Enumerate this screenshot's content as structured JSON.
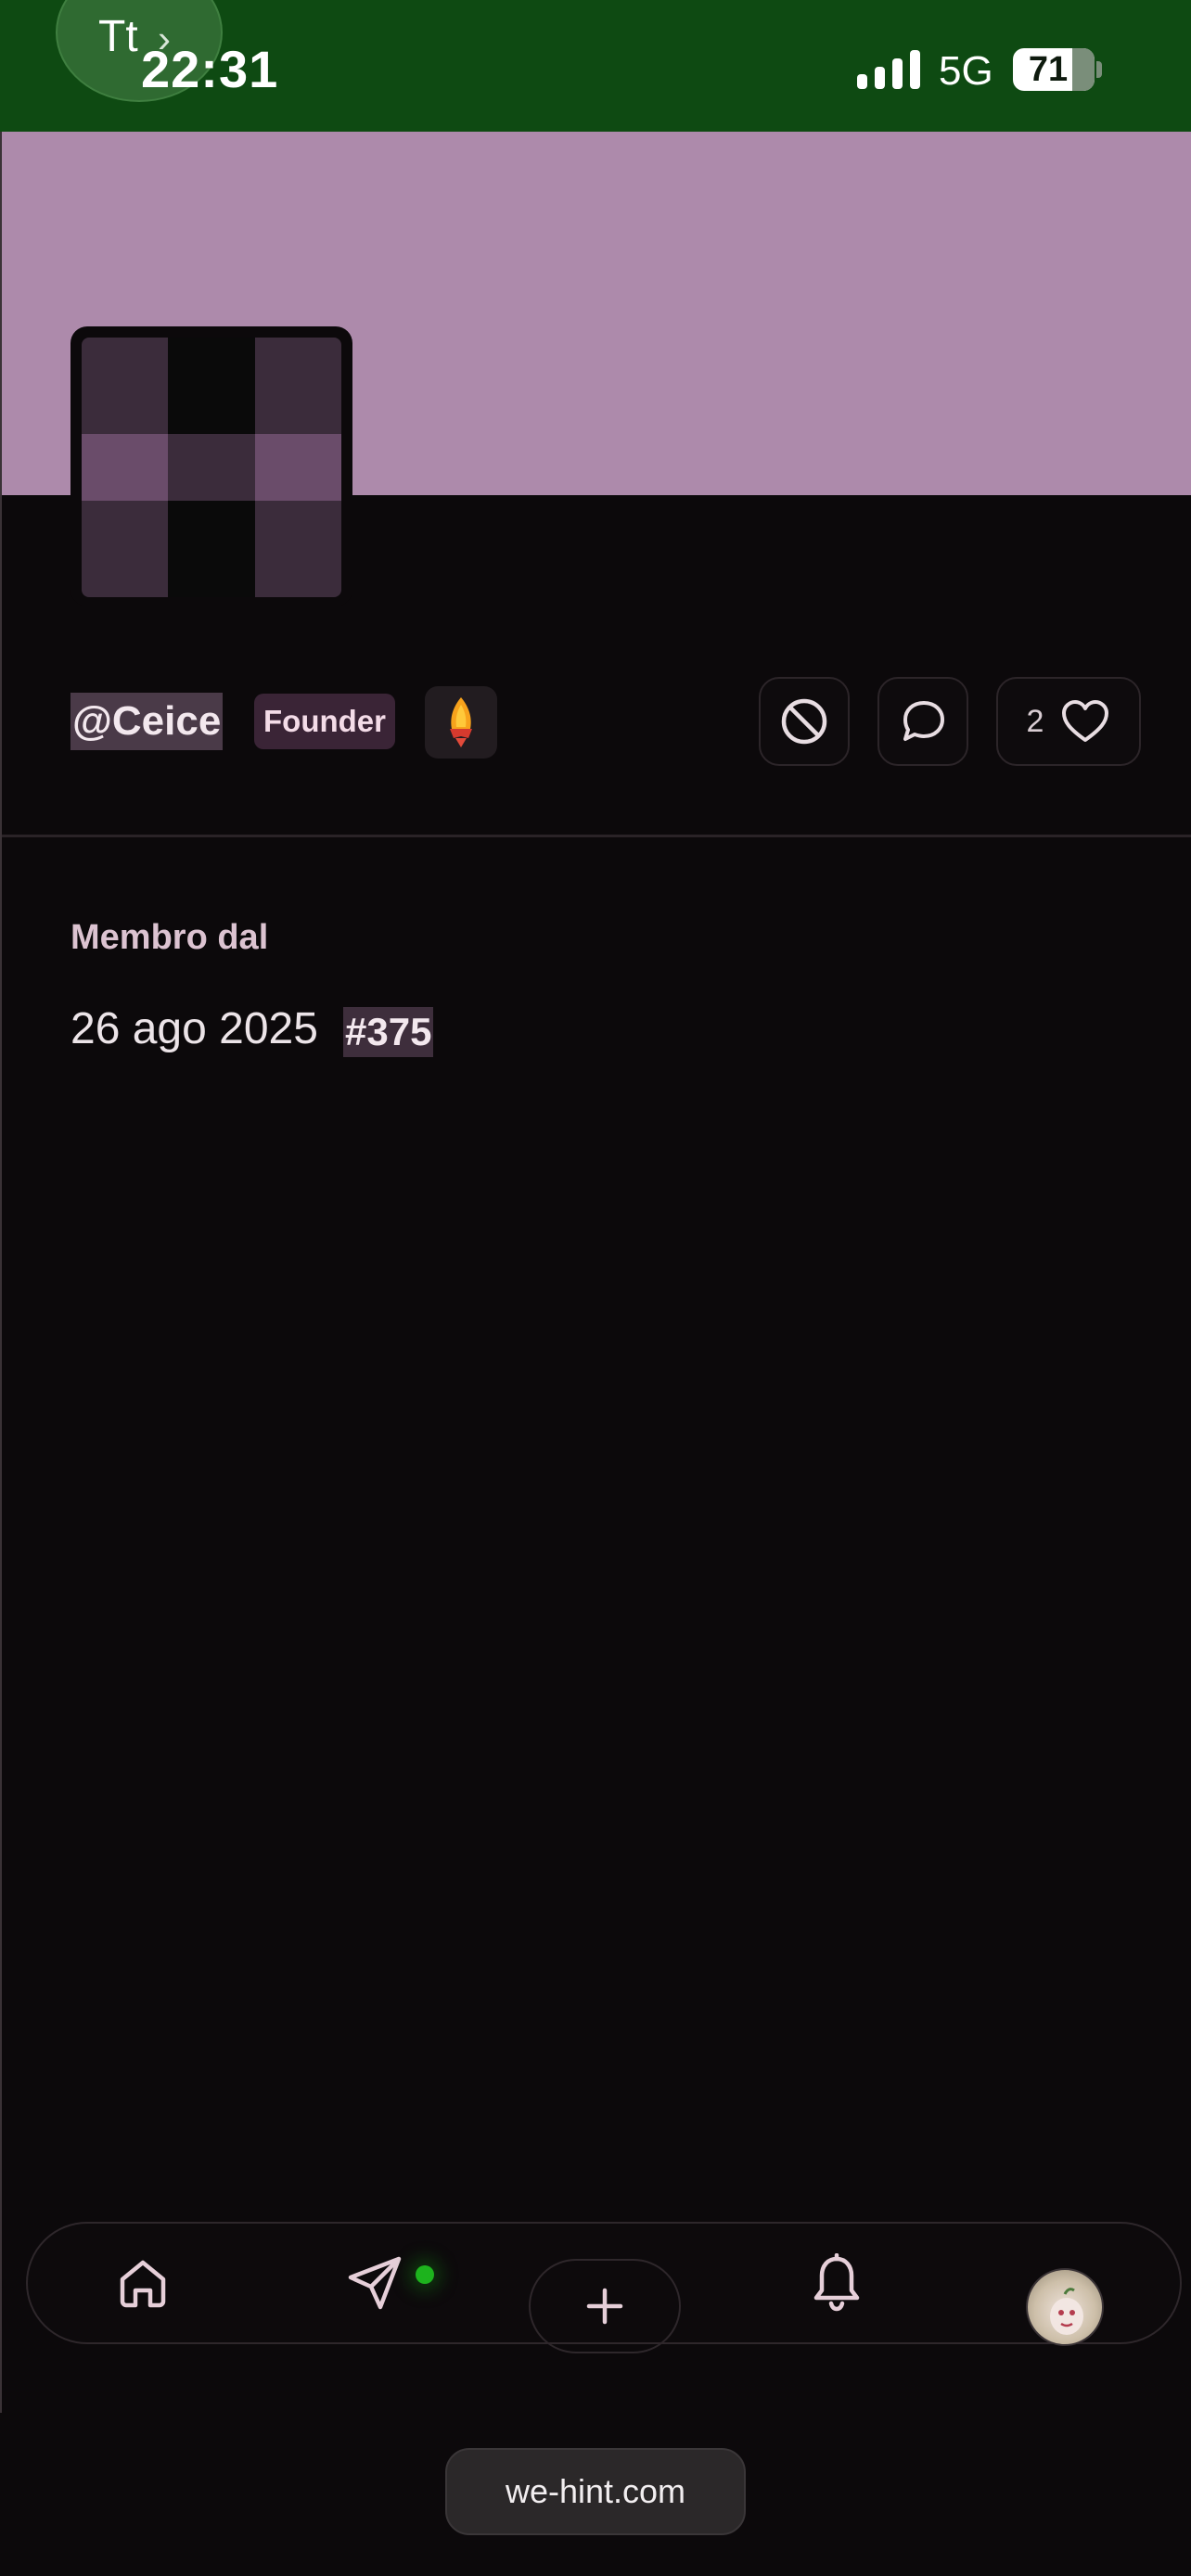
{
  "status_bar": {
    "translate_label": "Tt",
    "time": "22:31",
    "network": "5G",
    "battery": "71",
    "background_color": "#0e4a12"
  },
  "profile": {
    "banner_color": "#ad8aab",
    "avatar_colors": [
      "#3b2c3b",
      "#0a0a0a",
      "#3b2c3b",
      "#6a4c6a",
      "#3b2c3b",
      "#6a4c6a",
      "#3b2c3b",
      "#0a0a0a",
      "#3b2c3b"
    ],
    "username": "@Ceice",
    "role_badge": "Founder",
    "rocket_badge_icon": "rocket-icon",
    "actions": {
      "block_icon": "block-icon",
      "message_icon": "chat-bubble-icon",
      "like_count": "2",
      "like_icon": "heart-icon"
    }
  },
  "membership": {
    "label": "Membro dal",
    "date": "26 ago 2025",
    "member_number": "#375"
  },
  "bottom_nav": {
    "items": [
      "home-icon",
      "send-icon",
      "plus-icon",
      "bell-icon",
      "avatar"
    ],
    "online_dot_color": "#1db31d"
  },
  "browser": {
    "url": "we-hint.com"
  }
}
